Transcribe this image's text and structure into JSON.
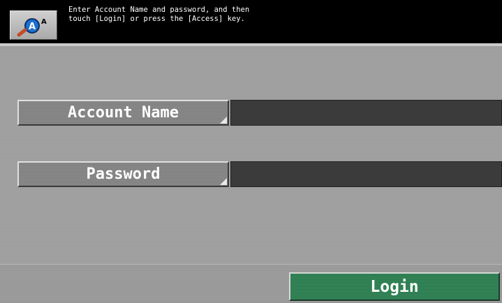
{
  "header": {
    "zoom_button_icon": "magnifier-zoom-icon",
    "message_line1": "Enter Account Name and password, and then",
    "message_line2": "touch [Login] or press the [Access] key."
  },
  "form": {
    "account_name_label": "Account Name",
    "account_name_value": "",
    "password_label": "Password",
    "password_value": ""
  },
  "footer": {
    "login_label": "Login"
  },
  "colors": {
    "header_bg": "#000000",
    "content_bg": "#9f9f9f",
    "field_bg": "#3b3b3b",
    "login_bg": "#2f7f53"
  }
}
